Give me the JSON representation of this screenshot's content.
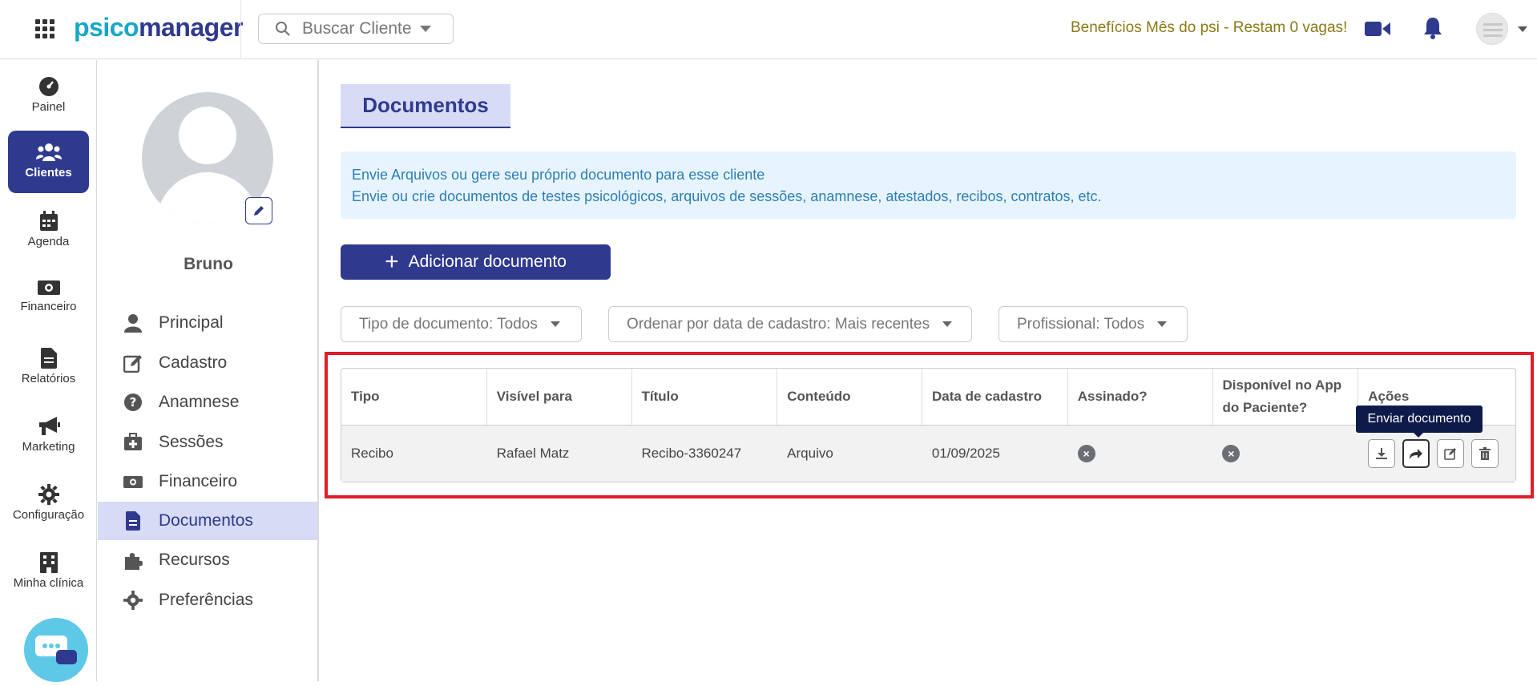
{
  "header": {
    "logo_part1": "psico",
    "logo_part2": "manager",
    "search_placeholder": "Buscar Cliente",
    "promo_text": "Benefícios Mês do psi - Restam 0 vagas!"
  },
  "nav": {
    "items": [
      {
        "label": "Painel",
        "icon": "dashboard-icon"
      },
      {
        "label": "Clientes",
        "icon": "users-icon",
        "active": true
      },
      {
        "label": "Agenda",
        "icon": "calendar-icon"
      },
      {
        "label": "Financeiro",
        "icon": "money-icon"
      },
      {
        "label": "Relatórios",
        "icon": "file-icon"
      },
      {
        "label": "Marketing",
        "icon": "megaphone-icon"
      },
      {
        "label": "Configuração",
        "icon": "gear-icon"
      },
      {
        "label": "Minha clínica",
        "icon": "building-icon"
      }
    ]
  },
  "client": {
    "name": "Bruno",
    "menu": [
      {
        "label": "Principal",
        "icon": "user-icon"
      },
      {
        "label": "Cadastro",
        "icon": "edit-icon"
      },
      {
        "label": "Anamnese",
        "icon": "question-icon"
      },
      {
        "label": "Sessões",
        "icon": "first-aid-icon"
      },
      {
        "label": "Financeiro",
        "icon": "money-icon"
      },
      {
        "label": "Documentos",
        "icon": "document-icon",
        "active": true
      },
      {
        "label": "Recursos",
        "icon": "puzzle-icon"
      },
      {
        "label": "Preferências",
        "icon": "gear-icon"
      }
    ]
  },
  "main": {
    "title": "Documentos",
    "info_line1": "Envie Arquivos ou gere seu próprio documento para esse cliente",
    "info_line2": "Envie ou crie documentos de testes psicológicos, arquivos de sessões, anamnese, atestados, recibos, contratos, etc.",
    "add_button": "Adicionar documento",
    "filters": {
      "tipo": "Tipo de documento: Todos",
      "ordenar": "Ordenar por data de cadastro: Mais recentes",
      "profissional": "Profissional: Todos"
    },
    "table": {
      "headers": [
        "Tipo",
        "Visível para",
        "Título",
        "Conteúdo",
        "Data de cadastro",
        "Assinado?",
        "Disponível no App do Paciente?",
        "Ações"
      ],
      "rows": [
        {
          "tipo": "Recibo",
          "visivel": "Rafael Matz",
          "titulo": "Recibo-3360247",
          "conteudo": "Arquivo",
          "data": "01/09/2025"
        }
      ]
    },
    "tooltip": "Enviar documento"
  },
  "colors": {
    "primary": "#2f3a8f",
    "accent": "#17a7c9",
    "highlight": "#e01e2b",
    "promo": "#8a7a16"
  }
}
